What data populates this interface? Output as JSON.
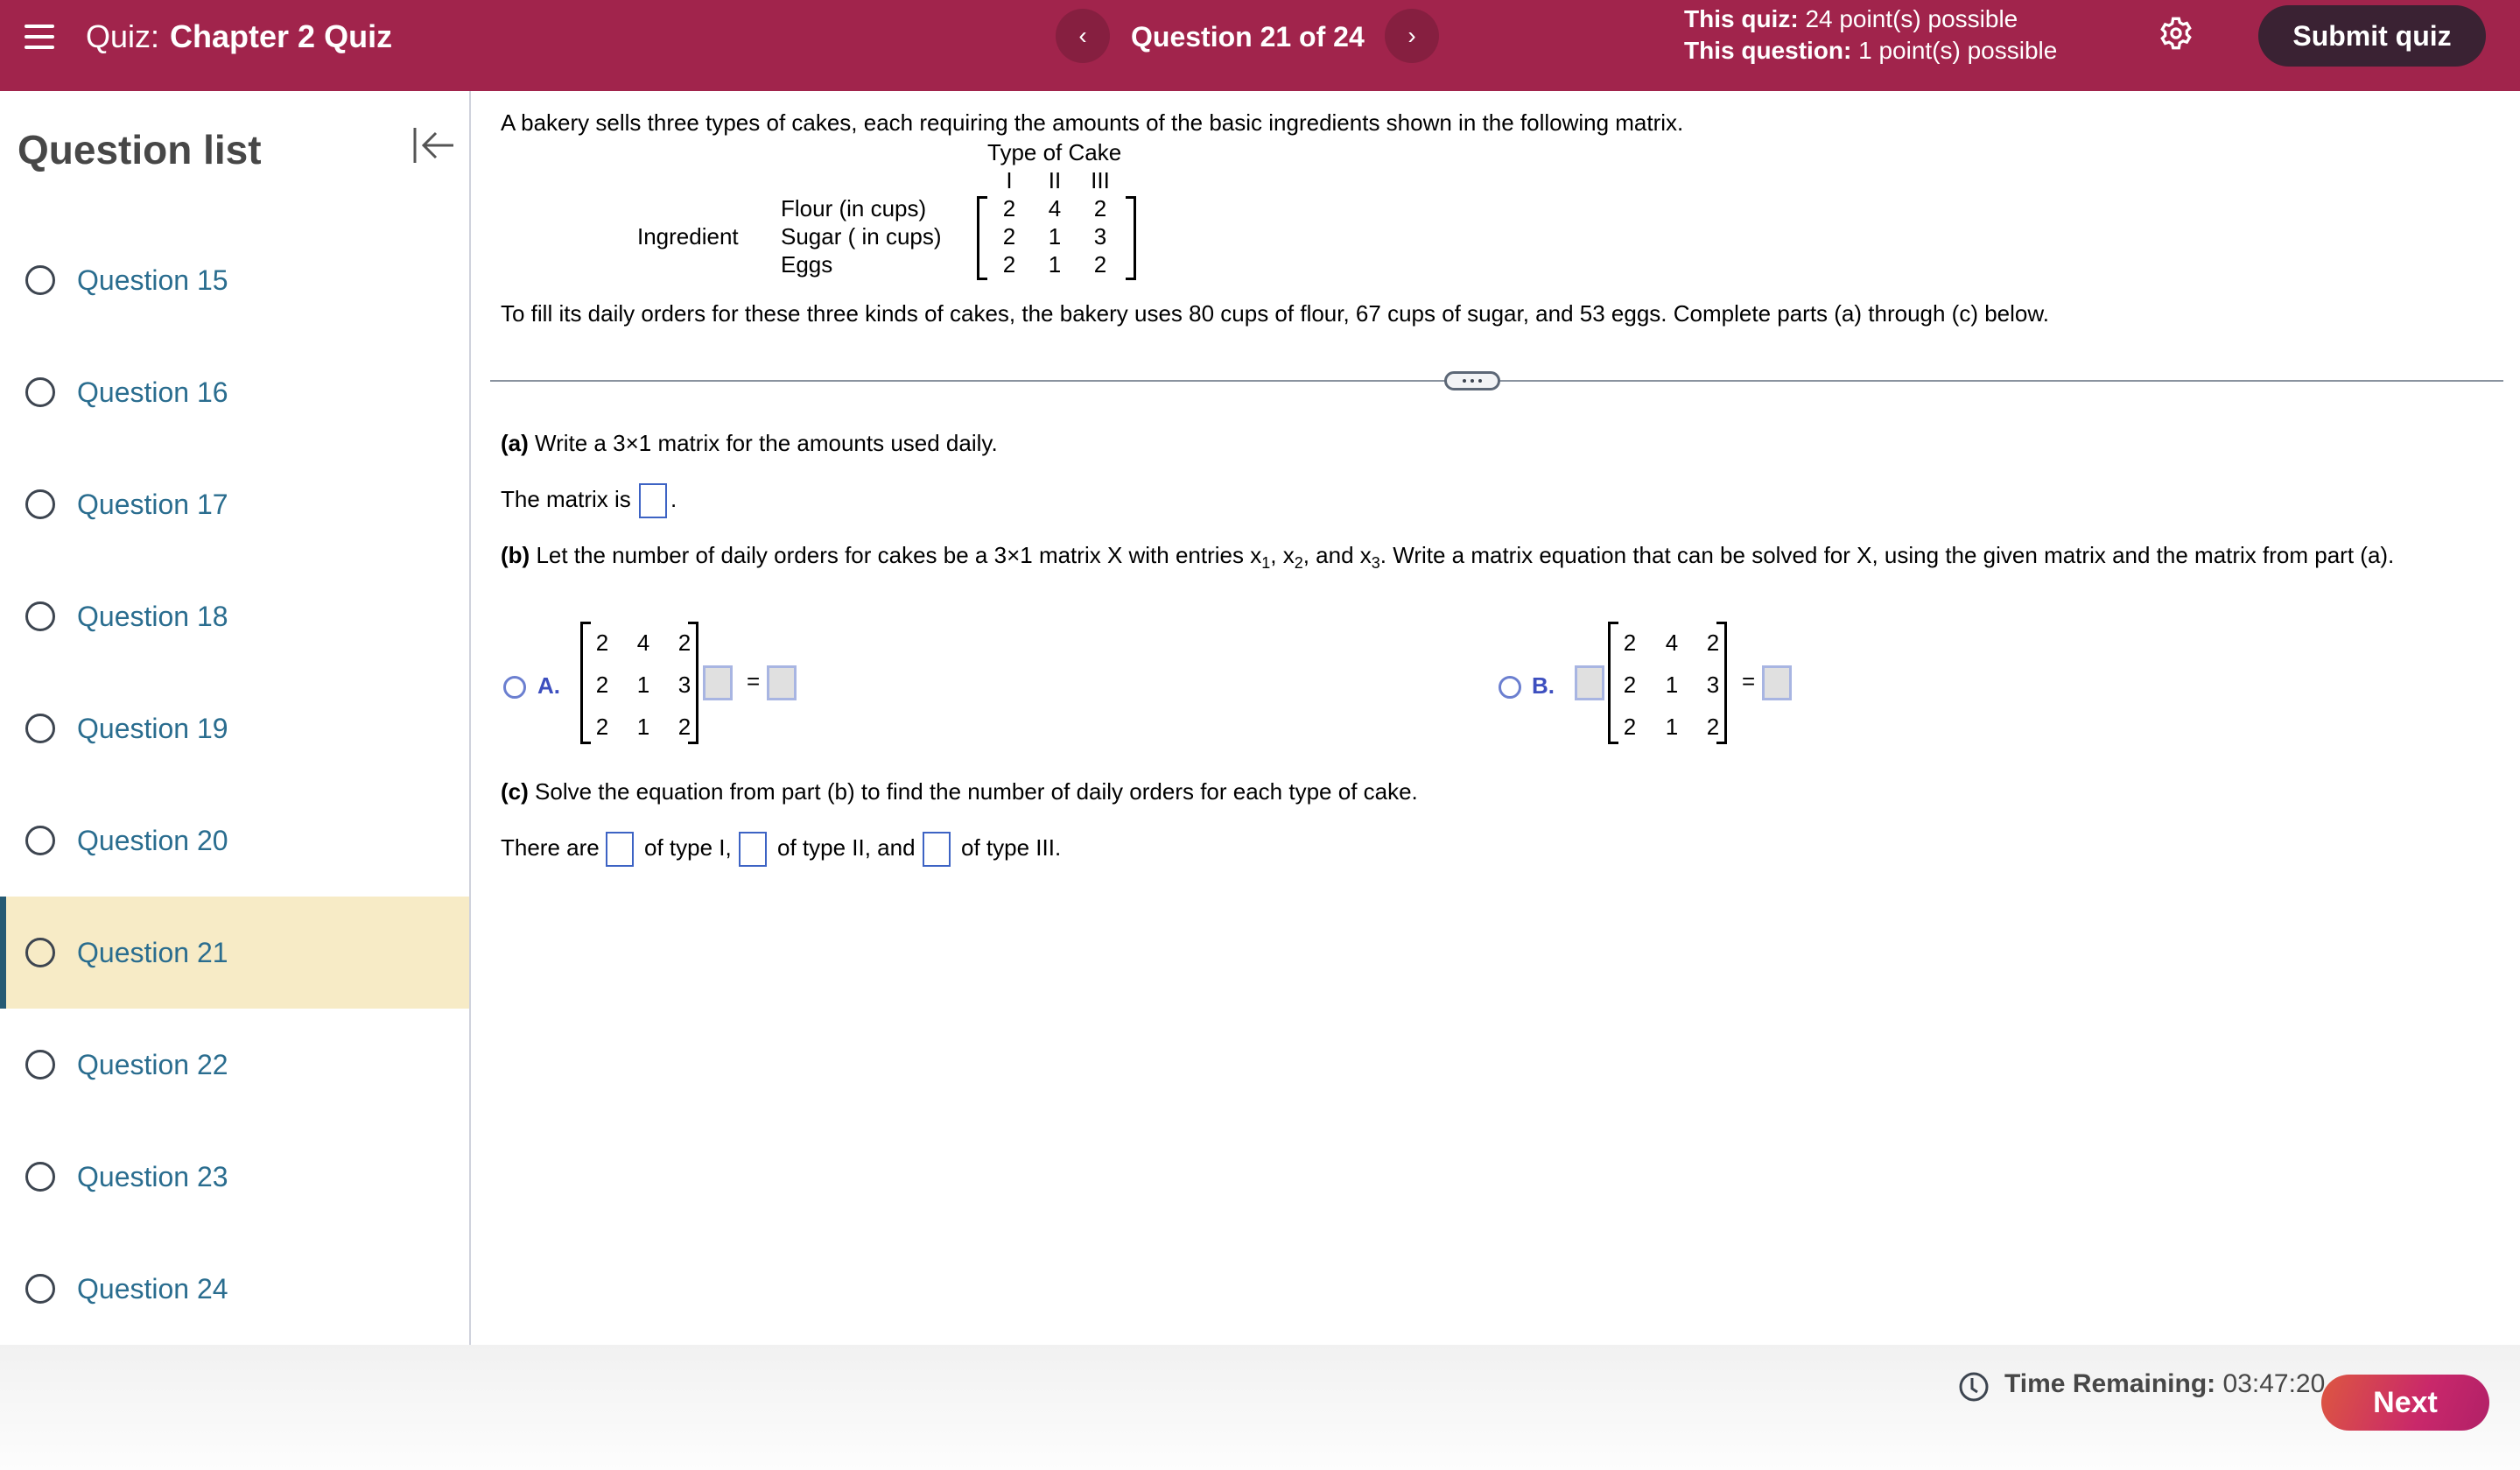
{
  "header": {
    "quiz_prefix": "Quiz:",
    "quiz_name": "Chapter 2 Quiz",
    "prev_label": "‹",
    "next_label": "›",
    "question_counter": "Question 21 of 24",
    "quiz_points_label": "This quiz:",
    "quiz_points_value": "24 point(s) possible",
    "question_points_label": "This question:",
    "question_points_value": "1 point(s) possible",
    "submit_label": "Submit quiz",
    "brand_color": "#a1244c"
  },
  "sidebar": {
    "title": "Question list",
    "items": [
      {
        "label": "Question 15",
        "active": false
      },
      {
        "label": "Question 16",
        "active": false
      },
      {
        "label": "Question 17",
        "active": false
      },
      {
        "label": "Question 18",
        "active": false
      },
      {
        "label": "Question 19",
        "active": false
      },
      {
        "label": "Question 20",
        "active": false
      },
      {
        "label": "Question 21",
        "active": true
      },
      {
        "label": "Question 22",
        "active": false
      },
      {
        "label": "Question 23",
        "active": false
      },
      {
        "label": "Question 24",
        "active": false
      }
    ]
  },
  "question": {
    "intro": "A bakery sells three types of cakes, each requiring the amounts of the basic ingredients shown in the following matrix.",
    "matrix_col_header": "Type of Cake",
    "matrix_cols": [
      "I",
      "II",
      "III"
    ],
    "matrix_row_group": "Ingredient",
    "matrix_rows": [
      "Flour (in cups)",
      "Sugar ( in cups)",
      "Eggs"
    ],
    "matrix_values": [
      [
        "2",
        "4",
        "2"
      ],
      [
        "2",
        "1",
        "3"
      ],
      [
        "2",
        "1",
        "2"
      ]
    ],
    "daily_usage": "To fill its daily orders for these three kinds of cakes, the bakery uses 80 cups of flour, 67 cups of sugar, and 53 eggs. Complete parts (a) through (c) below.",
    "part_a_label": "(a)",
    "part_a_text": "Write a 3×1 matrix for the amounts used daily.",
    "part_a_answer_prefix": "The matrix is",
    "part_a_answer_suffix": ".",
    "part_b_label": "(b)",
    "part_b_text_1": "Let the number of daily orders for cakes be a 3×1 matrix X with entries x",
    "part_b_sub_1": "1",
    "part_b_text_2": ", x",
    "part_b_sub_2": "2",
    "part_b_text_3": ", and x",
    "part_b_sub_3": "3",
    "part_b_text_4": ". Write a matrix equation that can be solved for X, using the given matrix and the matrix from part (a).",
    "choice_a_letter": "A.",
    "choice_b_letter": "B.",
    "equals": "=",
    "part_c_label": "(c)",
    "part_c_text": "Solve the equation from part (b) to find the number of daily orders for each type of cake.",
    "part_c_prefix": "There are",
    "part_c_t1": "of type I,",
    "part_c_t2": "of type II, and",
    "part_c_t3": "of type III."
  },
  "footer": {
    "time_label": "Time Remaining:",
    "time_value": "03:47:20",
    "next_label": "Next"
  }
}
